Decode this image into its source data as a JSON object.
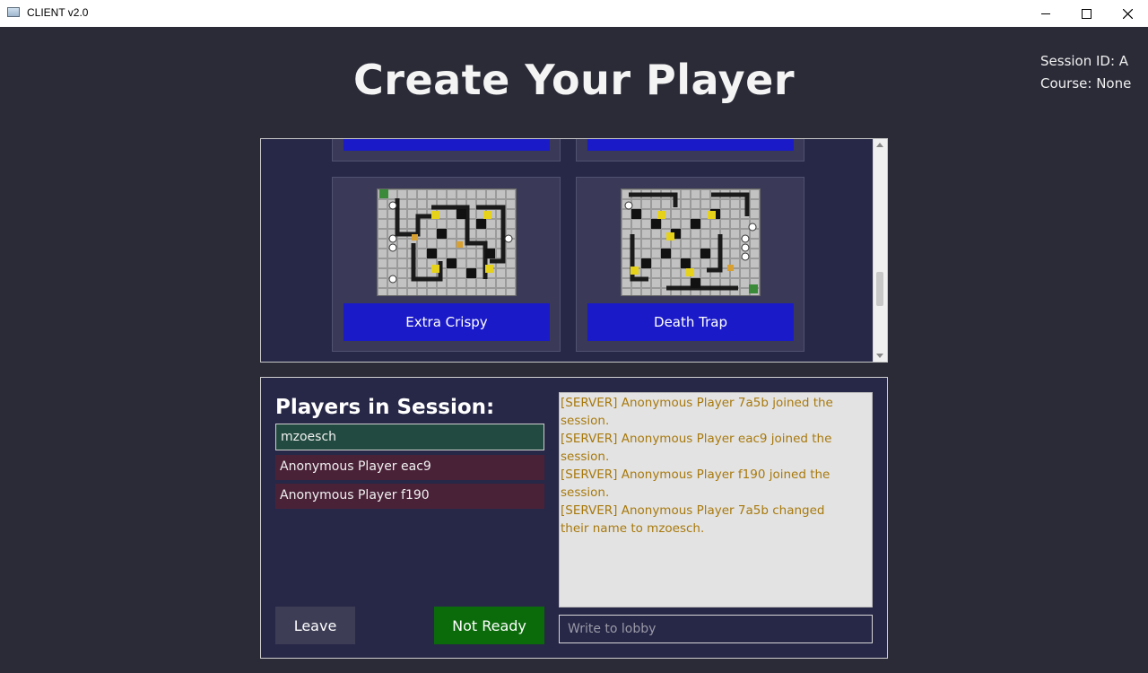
{
  "window": {
    "title": "CLIENT v2.0",
    "icon": "app-window-icon",
    "controls": [
      "minimize-icon",
      "maximize-icon",
      "close-icon"
    ]
  },
  "header": {
    "title": "Create Your Player",
    "session_id": "Session ID: A",
    "course": "Course: None"
  },
  "courses": {
    "partial_top": [
      {
        "label": ""
      },
      {
        "label": ""
      }
    ],
    "items": [
      {
        "label": "Extra Crispy",
        "thumb_icon": "course-map-preview"
      },
      {
        "label": "Death Trap",
        "thumb_icon": "course-map-preview"
      }
    ]
  },
  "lobby": {
    "heading": "Players in Session:",
    "players": [
      {
        "name": "mzoesch",
        "is_self": true
      },
      {
        "name": "Anonymous Player eac9",
        "is_self": false
      },
      {
        "name": "Anonymous Player f190",
        "is_self": false
      }
    ],
    "leave_label": "Leave",
    "ready_label": "Not Ready",
    "chat": [
      "[SERVER] Anonymous Player 7a5b joined the session.",
      "[SERVER] Anonymous Player eac9 joined the session.",
      "[SERVER] Anonymous Player f190 joined the session.",
      "[SERVER] Anonymous Player 7a5b changed their name to mzoesch."
    ],
    "chat_placeholder": "Write to lobby"
  },
  "colors": {
    "background": "#2b2b38",
    "panel": "#272747",
    "course_button": "#1a1ac8",
    "self_player": "#234a40",
    "other_player": "#4a2238",
    "ready_button": "#0b6b0b",
    "chat_text": "#a8790c"
  }
}
